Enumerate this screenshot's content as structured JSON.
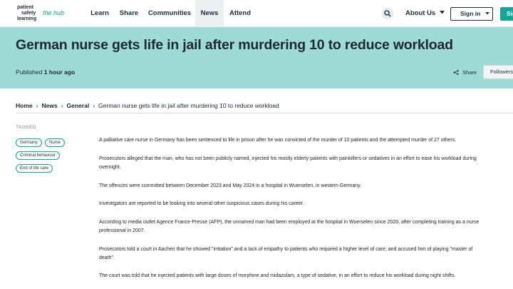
{
  "logo": {
    "line1": "patient",
    "line2": "safety",
    "line3": "learning",
    "hub": "the hub"
  },
  "nav": {
    "items": [
      "Learn",
      "Share",
      "Communities",
      "News",
      "Attend"
    ],
    "active": "News",
    "about": "About Us",
    "signin": "Sign in",
    "signup": "Sign up"
  },
  "colors": {
    "accent": "#17a49a",
    "hero": "#9edbd5",
    "dark": "#1b2935"
  },
  "article": {
    "title": "German nurse gets life in jail after murdering 10 to reduce workload",
    "published_prefix": "Published",
    "published_time": "1 hour ago",
    "share": "Share",
    "followers": "Followers",
    "breadcrumb": [
      "Home",
      "News",
      "General"
    ],
    "breadcrumb_current": "German nurse gets life in jail after murdering 10 to reduce workload",
    "tagged_label": "TAGGED",
    "tags": [
      "Germany",
      "Nurse",
      "Criminal behaviour",
      "End of life care"
    ],
    "paragraphs": [
      [
        "A palliative care nurse in Germany has been sentenced to life in prison after he was convicted of the murder of 10 patients and the attempted murder of 27 others."
      ],
      [
        "Prosecutors alleged that the man, who has not been publicly named, injected his mostly elderly patients with painkillers or sedatives in an effort to ease his workload during",
        "overnight."
      ],
      [
        "The offences were committed between December 2023 and May 2024 in a hospital in Wuerselen, in western Germany."
      ],
      [
        "Investigators are reported to be looking into several other suspicious cases during his career."
      ],
      [
        "According to media outlet Agence France-Presse (AFP), the unnamed man had been employed at the hospital in Wuerselen since 2020, after completing training as a nurse",
        "professional in 2007."
      ],
      [
        "Prosecutors told a court in Aachen that he showed \"irritation\" and a lack of empathy to patients who required a higher level of care, and accused him of playing \"master of",
        "death\"."
      ],
      [
        "The court was told that he injected patients with large doses of morphine and midazolam, a type of sedative, in an effort to reduce his workload during night shifts."
      ]
    ]
  }
}
